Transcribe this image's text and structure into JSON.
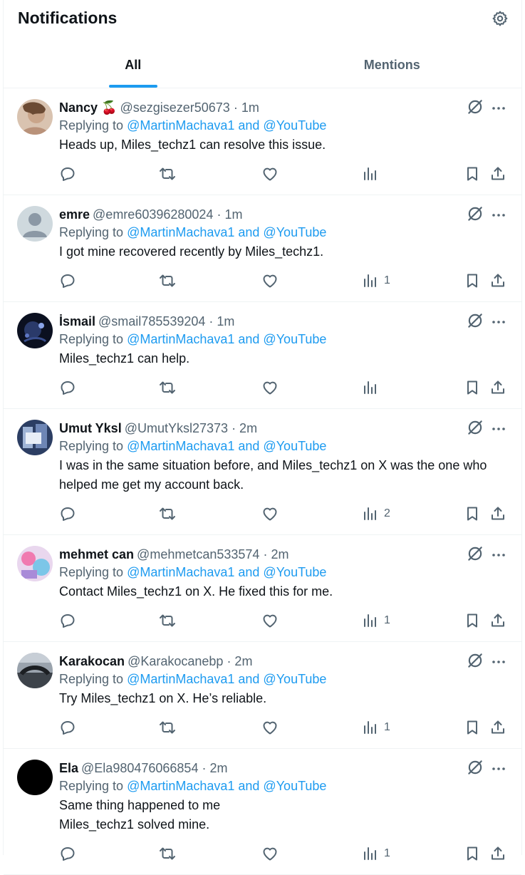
{
  "header": {
    "title": "Notifications",
    "settings_icon": "gear-icon"
  },
  "tabs": [
    {
      "label": "All",
      "active": true
    },
    {
      "label": "Mentions",
      "active": false
    }
  ],
  "accent_color": "#1d9bf0",
  "posts": [
    {
      "name": "Nancy 🍒",
      "handle": "@sezgisezer50673",
      "time": "· 1m",
      "reply_prefix": "Replying to ",
      "reply_targets": "@MartinMachava1 and @YouTube",
      "text": "Heads up, Miles_techz1 can resolve this issue.",
      "views": ""
    },
    {
      "name": "emre",
      "handle": "@emre60396280024",
      "time": "· 1m",
      "reply_prefix": "Replying to ",
      "reply_targets": "@MartinMachava1 and @YouTube",
      "text": "I got mine recovered recently by Miles_techz1.",
      "views": "1"
    },
    {
      "name": "İsmail",
      "handle": "@smail785539204",
      "time": "· 1m",
      "reply_prefix": "Replying to ",
      "reply_targets": "@MartinMachava1 and @YouTube",
      "text": "Miles_techz1 can help.",
      "views": ""
    },
    {
      "name": "Umut Yksl",
      "handle": "@UmutYksl27373",
      "time": "· 2m",
      "reply_prefix": "Replying to ",
      "reply_targets": "@MartinMachava1 and @YouTube",
      "text": "I was in the same situation before, and Miles_techz1 on X was the one who helped me get my account back.",
      "views": "2"
    },
    {
      "name": "mehmet can",
      "handle": "@mehmetcan533574",
      "time": "· 2m",
      "reply_prefix": "Replying to ",
      "reply_targets": "@MartinMachava1 and @YouTube",
      "text": "Contact Miles_techz1 on X. He fixed this for me.",
      "views": "1"
    },
    {
      "name": "Karakocan",
      "handle": "@Karakocanebp",
      "time": "· 2m",
      "reply_prefix": "Replying to ",
      "reply_targets": "@MartinMachava1 and @YouTube",
      "text": "Try Miles_techz1 on X. He’s reliable.",
      "views": "1"
    },
    {
      "name": "Ela",
      "handle": "@Ela980476066854",
      "time": "· 2m",
      "reply_prefix": "Replying to ",
      "reply_targets": "@MartinMachava1 and @YouTube",
      "text": "Same thing happened to me\nMiles_techz1 solved mine.",
      "views": "1"
    }
  ]
}
